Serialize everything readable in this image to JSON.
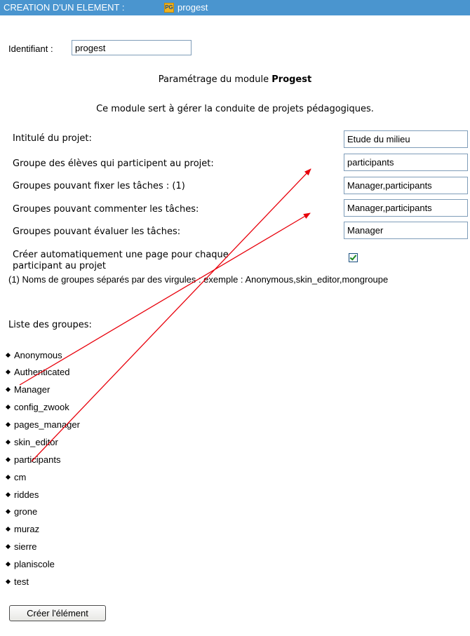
{
  "header": {
    "title": "CREATION D'UN ELEMENT :",
    "app_icon": "progest-logo-icon",
    "app_name": "progest"
  },
  "identifier": {
    "label": "Identifiant :",
    "value": "progest"
  },
  "module_heading": {
    "prefix": "Paramétrage du module ",
    "name": "Progest"
  },
  "module_description": "Ce module sert à gérer la conduite de projets pédagogiques.",
  "fields": [
    {
      "label": "Intitulé du projet:",
      "value": "Etude du milieu"
    },
    {
      "label": "Groupe des élèves qui participent au projet:",
      "value": "participants"
    },
    {
      "label": "Groupes pouvant fixer les tâches : (1)",
      "value": "Manager,participants"
    },
    {
      "label": "Groupes pouvant commenter les tâches:",
      "value": "Manager,participants"
    },
    {
      "label": "Groupes pouvant évaluer les tâches:",
      "value": "Manager"
    }
  ],
  "auto_page": {
    "label_line1": "Créer automatiquement une page pour chaque",
    "label_line2": "participant au projet",
    "checked": true
  },
  "footnote": "(1) Noms de groupes séparés par des virgules : exemple : Anonymous,skin_editor,mongroupe",
  "groups": {
    "title": "Liste des groupes:",
    "items": [
      "Anonymous",
      "Authenticated",
      "Manager",
      "config_zwook",
      "pages_manager",
      "skin_editor",
      "participants",
      "cm",
      "riddes",
      "grone",
      "muraz",
      "sierre",
      "planiscole",
      "test"
    ]
  },
  "submit_label": "Créer l'élément",
  "annotation_color": "#e8000b"
}
